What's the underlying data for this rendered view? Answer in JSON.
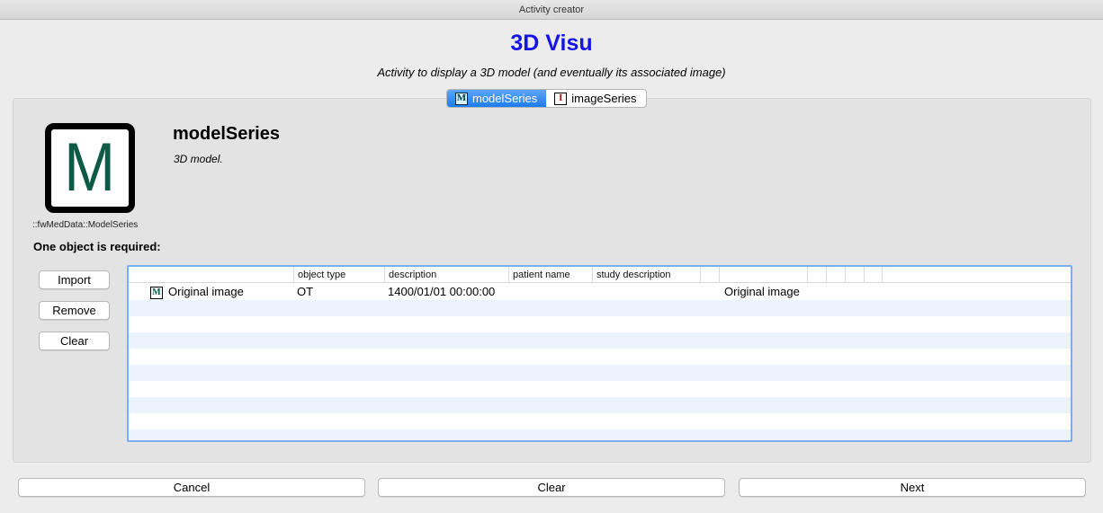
{
  "window": {
    "title": "Activity creator"
  },
  "activity": {
    "title": "3D Visu",
    "description": "Activity to display a 3D model (and eventually its associated image)"
  },
  "tabs": [
    {
      "label": "modelSeries",
      "icon": "M",
      "active": true
    },
    {
      "label": "imageSeries",
      "icon": "I",
      "active": false
    }
  ],
  "requirement": {
    "icon_letter": "M",
    "type_label": "::fwMedData::ModelSeries",
    "name": "modelSeries",
    "description": "3D model.",
    "required_text": "One object is required:"
  },
  "side_buttons": {
    "import": "Import",
    "remove": "Remove",
    "clear": "Clear"
  },
  "table": {
    "columns": [
      "",
      "object type",
      "description",
      "patient name",
      "study description",
      "",
      "",
      "",
      "",
      "",
      ""
    ],
    "rows": [
      {
        "icon": "M",
        "name": "Original image",
        "object_type": "OT",
        "description": "1400/01/01 00:00:00",
        "extra": "Original image"
      }
    ]
  },
  "footer": {
    "cancel": "Cancel",
    "clear": "Clear",
    "next": "Next"
  },
  "colors": {
    "title": "#1414e6",
    "tab_active": "#1d7cf0",
    "model_icon": "#0e5a47"
  }
}
